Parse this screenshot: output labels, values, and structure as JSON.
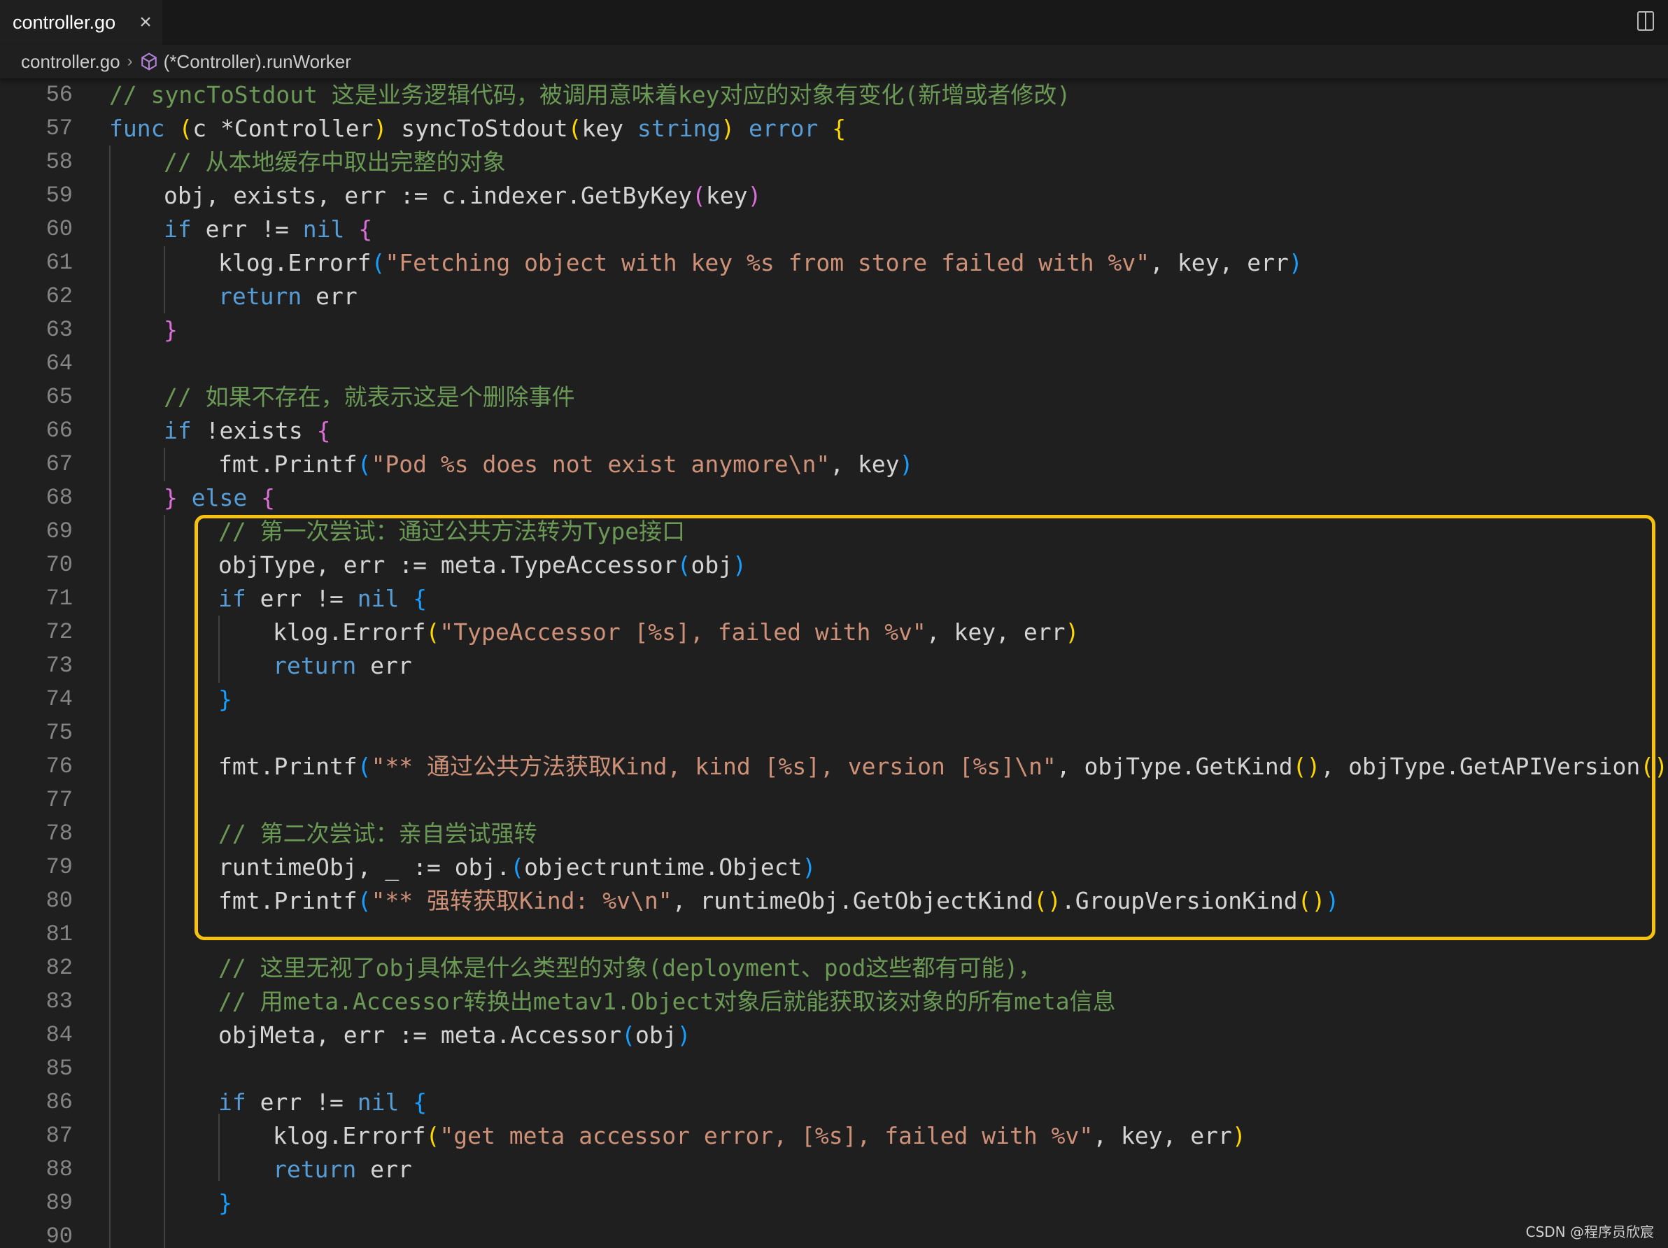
{
  "tab": {
    "filename": "controller.go"
  },
  "breadcrumb": {
    "file": "controller.go",
    "symbol": "(*Controller).runWorker"
  },
  "colors": {
    "comment": "#6a9955",
    "keyword": "#569cd6",
    "control": "#c586c0",
    "string": "#ce9178",
    "func": "#dcdcaa",
    "type": "#4ec9b0",
    "var": "#d4d4d4",
    "param": "#9cdcfe",
    "bracket1": "#ffd700",
    "bracket2": "#da70d6",
    "bracket3": "#179fff",
    "highlight": "#f6c20f"
  },
  "code_lines": [
    {
      "n": "56",
      "indent": 0,
      "tokens": [
        [
          "c",
          "// syncToStdout 这是业务逻辑代码，被调用意味着key对应的对象有变化(新增或者修改)"
        ]
      ]
    },
    {
      "n": "57",
      "indent": 0,
      "tokens": [
        [
          "k",
          "func"
        ],
        [
          "t",
          " "
        ],
        [
          "b1",
          "("
        ],
        [
          "t",
          "c *Controller"
        ],
        [
          "b1",
          ")"
        ],
        [
          "t",
          " syncToStdout"
        ],
        [
          "b1",
          "("
        ],
        [
          "t",
          "key "
        ],
        [
          "k",
          "string"
        ],
        [
          "b1",
          ")"
        ],
        [
          "t",
          " "
        ],
        [
          "k",
          "error"
        ],
        [
          "t",
          " "
        ],
        [
          "b1",
          "{"
        ]
      ]
    },
    {
      "n": "58",
      "indent": 1,
      "tokens": [
        [
          "c",
          "// 从本地缓存中取出完整的对象"
        ]
      ]
    },
    {
      "n": "59",
      "indent": 1,
      "tokens": [
        [
          "t",
          "obj, exists, err := c.indexer.GetByKey"
        ],
        [
          "b2",
          "("
        ],
        [
          "t",
          "key"
        ],
        [
          "b2",
          ")"
        ]
      ]
    },
    {
      "n": "60",
      "indent": 1,
      "tokens": [
        [
          "k",
          "if"
        ],
        [
          "t",
          " err != "
        ],
        [
          "k",
          "nil"
        ],
        [
          "t",
          " "
        ],
        [
          "b2",
          "{"
        ]
      ]
    },
    {
      "n": "61",
      "indent": 2,
      "tokens": [
        [
          "t",
          "klog.Errorf"
        ],
        [
          "b3",
          "("
        ],
        [
          "s",
          "\"Fetching object with key %s from store failed with %v\""
        ],
        [
          "t",
          ", key, err"
        ],
        [
          "b3",
          ")"
        ]
      ]
    },
    {
      "n": "62",
      "indent": 2,
      "tokens": [
        [
          "k",
          "return"
        ],
        [
          "t",
          " err"
        ]
      ]
    },
    {
      "n": "63",
      "indent": 1,
      "tokens": [
        [
          "b2",
          "}"
        ]
      ]
    },
    {
      "n": "64",
      "indent": 0,
      "tokens": []
    },
    {
      "n": "65",
      "indent": 1,
      "tokens": [
        [
          "c",
          "// 如果不存在，就表示这是个删除事件"
        ]
      ]
    },
    {
      "n": "66",
      "indent": 1,
      "tokens": [
        [
          "k",
          "if"
        ],
        [
          "t",
          " !exists "
        ],
        [
          "b2",
          "{"
        ]
      ]
    },
    {
      "n": "67",
      "indent": 2,
      "tokens": [
        [
          "t",
          "fmt.Printf"
        ],
        [
          "b3",
          "("
        ],
        [
          "s",
          "\"Pod %s does not exist anymore\\n\""
        ],
        [
          "t",
          ", key"
        ],
        [
          "b3",
          ")"
        ]
      ]
    },
    {
      "n": "68",
      "indent": 1,
      "tokens": [
        [
          "b2",
          "}"
        ],
        [
          "t",
          " "
        ],
        [
          "k",
          "else"
        ],
        [
          "t",
          " "
        ],
        [
          "b2",
          "{"
        ]
      ]
    },
    {
      "n": "69",
      "indent": 2,
      "tokens": [
        [
          "c",
          "// 第一次尝试：通过公共方法转为Type接口"
        ]
      ]
    },
    {
      "n": "70",
      "indent": 2,
      "tokens": [
        [
          "t",
          "objType, err := meta.TypeAccessor"
        ],
        [
          "b3",
          "("
        ],
        [
          "t",
          "obj"
        ],
        [
          "b3",
          ")"
        ]
      ]
    },
    {
      "n": "71",
      "indent": 2,
      "tokens": [
        [
          "k",
          "if"
        ],
        [
          "t",
          " err != "
        ],
        [
          "k",
          "nil"
        ],
        [
          "t",
          " "
        ],
        [
          "b3",
          "{"
        ]
      ]
    },
    {
      "n": "72",
      "indent": 3,
      "tokens": [
        [
          "t",
          "klog.Errorf"
        ],
        [
          "b1",
          "("
        ],
        [
          "s",
          "\"TypeAccessor [%s], failed with %v\""
        ],
        [
          "t",
          ", key, err"
        ],
        [
          "b1",
          ")"
        ]
      ]
    },
    {
      "n": "73",
      "indent": 3,
      "tokens": [
        [
          "k",
          "return"
        ],
        [
          "t",
          " err"
        ]
      ]
    },
    {
      "n": "74",
      "indent": 2,
      "tokens": [
        [
          "b3",
          "}"
        ]
      ]
    },
    {
      "n": "75",
      "indent": 0,
      "tokens": []
    },
    {
      "n": "76",
      "indent": 2,
      "tokens": [
        [
          "t",
          "fmt.Printf"
        ],
        [
          "b3",
          "("
        ],
        [
          "s",
          "\"** 通过公共方法获取Kind, kind [%s], version [%s]\\n\""
        ],
        [
          "t",
          ", objType.GetKind"
        ],
        [
          "b1",
          "()"
        ],
        [
          "t",
          ", objType.GetAPIVersion"
        ],
        [
          "b1",
          "()"
        ],
        [
          "b3",
          ")"
        ]
      ]
    },
    {
      "n": "77",
      "indent": 0,
      "tokens": []
    },
    {
      "n": "78",
      "indent": 2,
      "tokens": [
        [
          "c",
          "// 第二次尝试：亲自尝试强转"
        ]
      ]
    },
    {
      "n": "79",
      "indent": 2,
      "tokens": [
        [
          "t",
          "runtimeObj, _ := obj."
        ],
        [
          "b3",
          "("
        ],
        [
          "t",
          "objectruntime.Object"
        ],
        [
          "b3",
          ")"
        ]
      ]
    },
    {
      "n": "80",
      "indent": 2,
      "tokens": [
        [
          "t",
          "fmt.Printf"
        ],
        [
          "b3",
          "("
        ],
        [
          "s",
          "\"** 强转获取Kind: %v\\n\""
        ],
        [
          "t",
          ", runtimeObj.GetObjectKind"
        ],
        [
          "b1",
          "()"
        ],
        [
          "t",
          ".GroupVersionKind"
        ],
        [
          "b1",
          "()"
        ],
        [
          "b3",
          ")"
        ]
      ]
    },
    {
      "n": "81",
      "indent": 0,
      "tokens": []
    },
    {
      "n": "82",
      "indent": 2,
      "tokens": [
        [
          "c",
          "// 这里无视了obj具体是什么类型的对象(deployment、pod这些都有可能)，"
        ]
      ]
    },
    {
      "n": "83",
      "indent": 2,
      "tokens": [
        [
          "c",
          "// 用meta.Accessor转换出metav1.Object对象后就能获取该对象的所有meta信息"
        ]
      ]
    },
    {
      "n": "84",
      "indent": 2,
      "tokens": [
        [
          "t",
          "objMeta, err := meta.Accessor"
        ],
        [
          "b3",
          "("
        ],
        [
          "t",
          "obj"
        ],
        [
          "b3",
          ")"
        ]
      ]
    },
    {
      "n": "85",
      "indent": 0,
      "tokens": []
    },
    {
      "n": "86",
      "indent": 2,
      "tokens": [
        [
          "k",
          "if"
        ],
        [
          "t",
          " err != "
        ],
        [
          "k",
          "nil"
        ],
        [
          "t",
          " "
        ],
        [
          "b3",
          "{"
        ]
      ]
    },
    {
      "n": "87",
      "indent": 3,
      "tokens": [
        [
          "t",
          "klog.Errorf"
        ],
        [
          "b1",
          "("
        ],
        [
          "s",
          "\"get meta accessor error, [%s], failed with %v\""
        ],
        [
          "t",
          ", key, err"
        ],
        [
          "b1",
          ")"
        ]
      ]
    },
    {
      "n": "88",
      "indent": 3,
      "tokens": [
        [
          "k",
          "return"
        ],
        [
          "t",
          " err"
        ]
      ]
    },
    {
      "n": "89",
      "indent": 2,
      "tokens": [
        [
          "b3",
          "}"
        ]
      ]
    },
    {
      "n": "90",
      "indent": 0,
      "tokens": []
    }
  ],
  "watermark": "CSDN @程序员欣宸"
}
